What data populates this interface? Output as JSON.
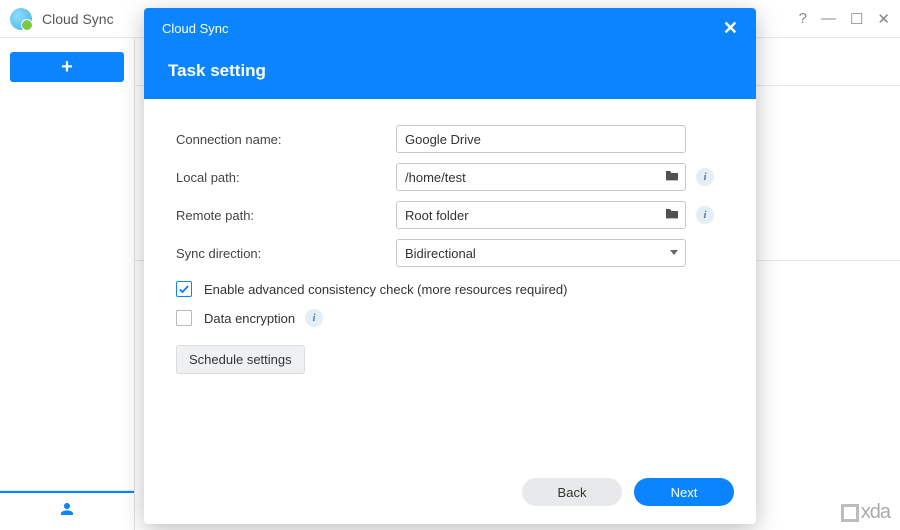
{
  "app": {
    "title": "Cloud Sync"
  },
  "window_controls": {
    "help": "?",
    "minimize": "—",
    "maximize": "☐",
    "close": "✕"
  },
  "sidebar": {
    "add_label": "+"
  },
  "modal": {
    "header_app": "Cloud Sync",
    "title": "Task setting",
    "labels": {
      "connection_name": "Connection name:",
      "local_path": "Local path:",
      "remote_path": "Remote path:",
      "sync_direction": "Sync direction:"
    },
    "values": {
      "connection_name": "Google Drive",
      "local_path": "/home/test",
      "remote_path": "Root folder",
      "sync_direction": "Bidirectional"
    },
    "checks": {
      "consistency_label": "Enable advanced consistency check (more resources required)",
      "consistency_checked": true,
      "encryption_label": "Data encryption",
      "encryption_checked": false
    },
    "schedule_button": "Schedule settings",
    "footer": {
      "back": "Back",
      "next": "Next"
    }
  },
  "watermark": {
    "text": "xda"
  }
}
